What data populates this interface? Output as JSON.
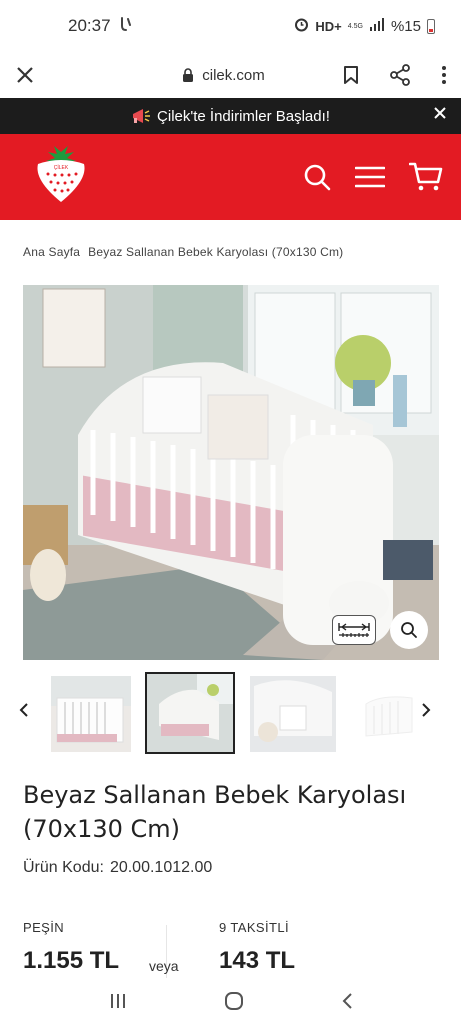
{
  "status_bar": {
    "time": "20:37",
    "network": "HD+",
    "network_sub": "4.5G",
    "battery_text": "%15"
  },
  "browser": {
    "url": "cilek.com"
  },
  "promo": {
    "text": "Çilek'te İndirimler Başladı!"
  },
  "header": {
    "logo_text": "ÇİLEK"
  },
  "breadcrumb": {
    "home": "Ana Sayfa",
    "current": "Beyaz Sallanan Bebek Karyolası (70x130 Cm)"
  },
  "product": {
    "title": "Beyaz Sallanan Bebek Karyolası (70x130 Cm)",
    "code_label": "Ürün Kodu:",
    "code_value": "20.00.1012.00"
  },
  "pricing": {
    "cash_label": "PEŞİN",
    "cash_price": "1.155 TL",
    "or_text": "veya",
    "installment_label": "9 TAKSİTLİ",
    "installment_price": "143 TL"
  },
  "colors": {
    "brand_red": "#e31b23",
    "promo_bg": "#1c1c1c",
    "crib_pink": "#e3b9c2"
  },
  "icons": [
    "close-icon",
    "lock-icon",
    "bookmark-icon",
    "share-icon",
    "more-icon",
    "megaphone-icon",
    "strawberry-logo",
    "search-icon",
    "menu-icon",
    "cart-icon",
    "ruler-icon",
    "zoom-icon",
    "chevron-left-icon",
    "chevron-right-icon",
    "recent-apps-icon",
    "home-icon",
    "back-icon"
  ]
}
